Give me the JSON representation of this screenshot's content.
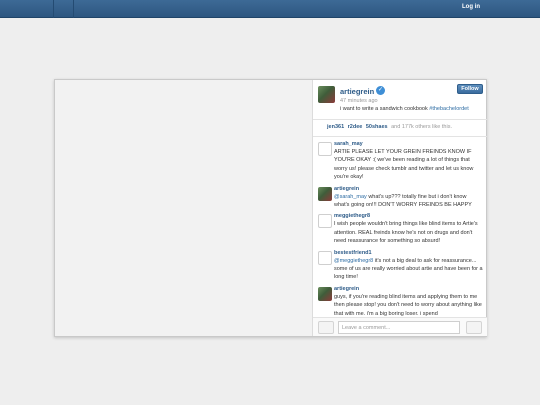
{
  "topbar": {
    "login_label": "Log in"
  },
  "post": {
    "username": "artiegrein",
    "verified_icon": "check-badge-icon",
    "time_ago": "47 minutes ago",
    "caption_text": "i want to write a sandwich cookbook ",
    "caption_hashtag": "#thebachelordet",
    "follow_label": "Follow"
  },
  "likes": {
    "users": [
      "jen361",
      "r2dee",
      "50shaes"
    ],
    "others_text": "and 177k others like this."
  },
  "comments": [
    {
      "user": "sarah_may",
      "mention": "",
      "text": "ARTIE PLEASE LET YOUR GREIN FREINDS KNOW IF YOU'RE OKAY :( we've been reading a lot of things that worry us! please check tumblr and twitter and let us know you're okay!"
    },
    {
      "user": "artiegrein",
      "mention": "@sarah_may",
      "text": " what's up??? totally fine but i don't know what's going on!!! DON'T WORRY FREINDS BE HAPPY"
    },
    {
      "user": "meggiethegr8",
      "mention": "",
      "text": "I wish people wouldn't bring things like blind items to Artie's attention. REAL freinds know he's not on drugs and don't need reassurance for something so absurd!"
    },
    {
      "user": "bestestfriend1",
      "mention": "@meggiethegr8",
      "text": " it's not a big deal to ask for reassurance... some of us are really worried about artie and have been for a long time!"
    },
    {
      "user": "artiegrein",
      "mention": "",
      "text": "guys, if you're reading blind items and applying them to me then please stop! you don't need to worry about anything like that with me. i'm a big boring loser. i spend"
    }
  ],
  "comment_box": {
    "placeholder": "Leave a comment..."
  }
}
